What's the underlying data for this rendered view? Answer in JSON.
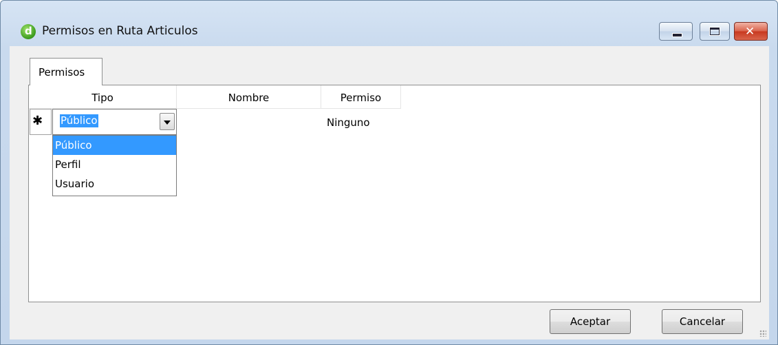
{
  "window": {
    "title": "Permisos en Ruta Articulos",
    "icon": "app-d-icon",
    "caption_buttons": [
      "minimize-icon",
      "maximize-icon",
      "close-icon"
    ],
    "close_glyph": "✕"
  },
  "tabs": [
    {
      "label": "Permisos",
      "selected": true
    }
  ],
  "grid": {
    "columns": [
      "Tipo",
      "Nombre",
      "Permiso"
    ],
    "new_row_marker": "✱",
    "row": {
      "tipo": "Público",
      "nombre": "",
      "permiso": "Ninguno"
    },
    "tipo_options": [
      "Público",
      "Perfil",
      "Usuario"
    ],
    "selected_option": "Público"
  },
  "buttons": {
    "ok": "Aceptar",
    "cancel": "Cancelar"
  },
  "colors": {
    "selection": "#3399ff",
    "close_button": "#c8381f"
  }
}
